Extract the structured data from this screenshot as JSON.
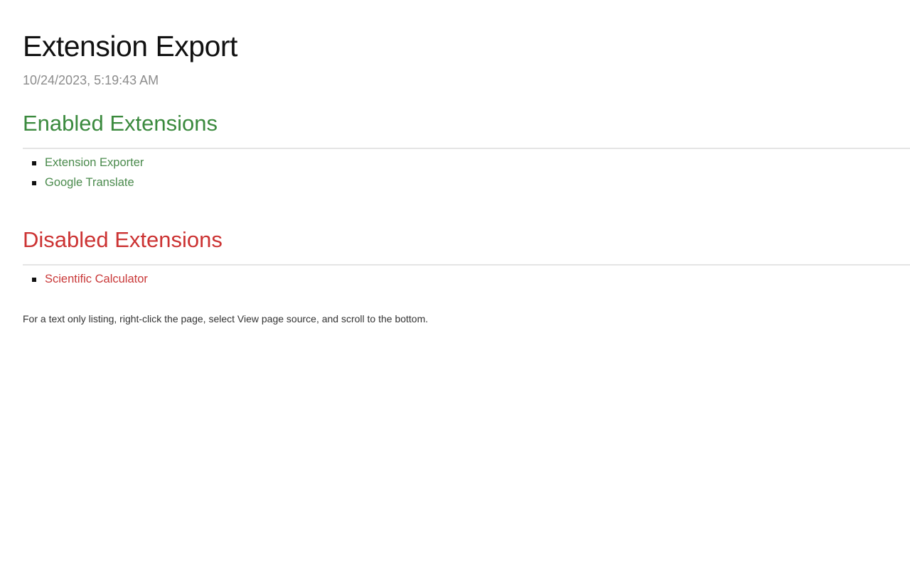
{
  "header": {
    "title": "Extension Export",
    "timestamp": "10/24/2023, 5:19:43 AM"
  },
  "enabled": {
    "title": "Enabled Extensions",
    "color": "#3b8a3e",
    "items": [
      {
        "label": "Extension Exporter"
      },
      {
        "label": "Google Translate"
      }
    ]
  },
  "disabled": {
    "title": "Disabled Extensions",
    "color": "#cc3333",
    "items": [
      {
        "label": "Scientific Calculator"
      }
    ]
  },
  "footnote": "For a text only listing, right-click the page, select View page source, and scroll to the bottom."
}
